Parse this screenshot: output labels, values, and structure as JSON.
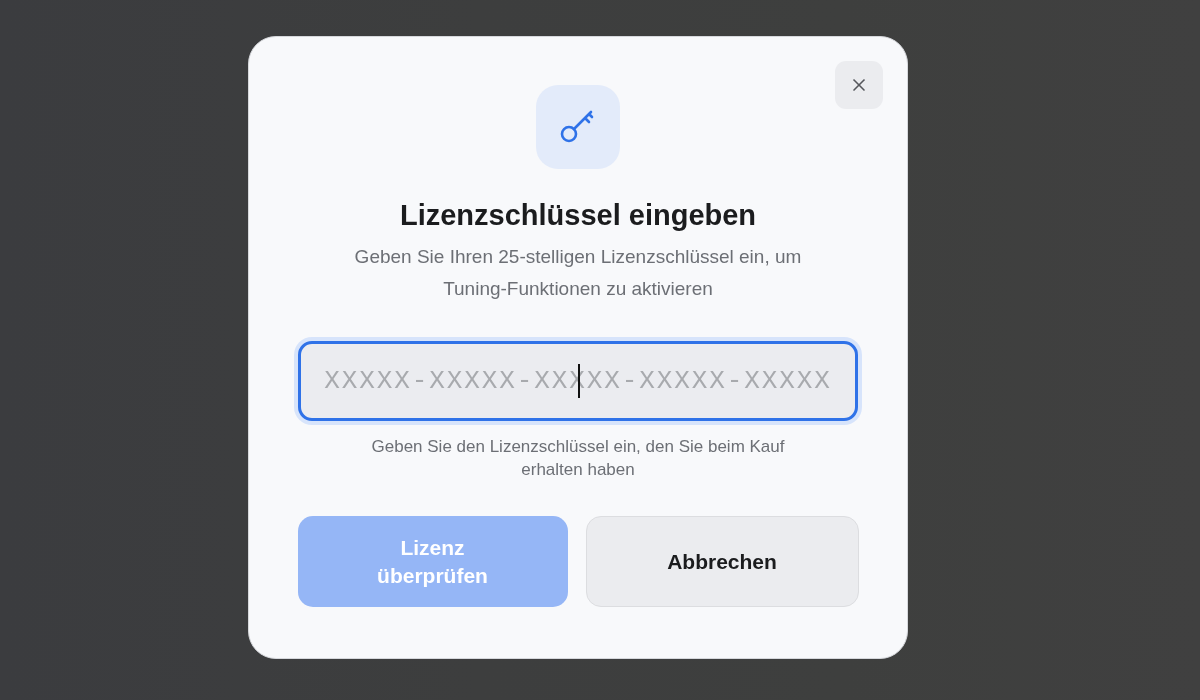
{
  "dialog": {
    "title": "Lizenzschlüssel eingeben",
    "description": "Geben Sie Ihren 25-stelligen Lizenzschlüssel ein, um Tuning-Funktionen zu aktivieren",
    "license_field": {
      "placeholder": "XXXXX-XXXXX-XXXXX-XXXXX-XXXXX",
      "focused": true
    },
    "hint": "Geben Sie den Lizenzschlüssel ein, den Sie beim Kauf erhalten haben",
    "buttons": [
      {
        "label": "Lizenz überprüfen",
        "kind": "primary",
        "disabled": true
      },
      {
        "label": "Abbrechen",
        "kind": "secondary",
        "disabled": false
      }
    ]
  }
}
